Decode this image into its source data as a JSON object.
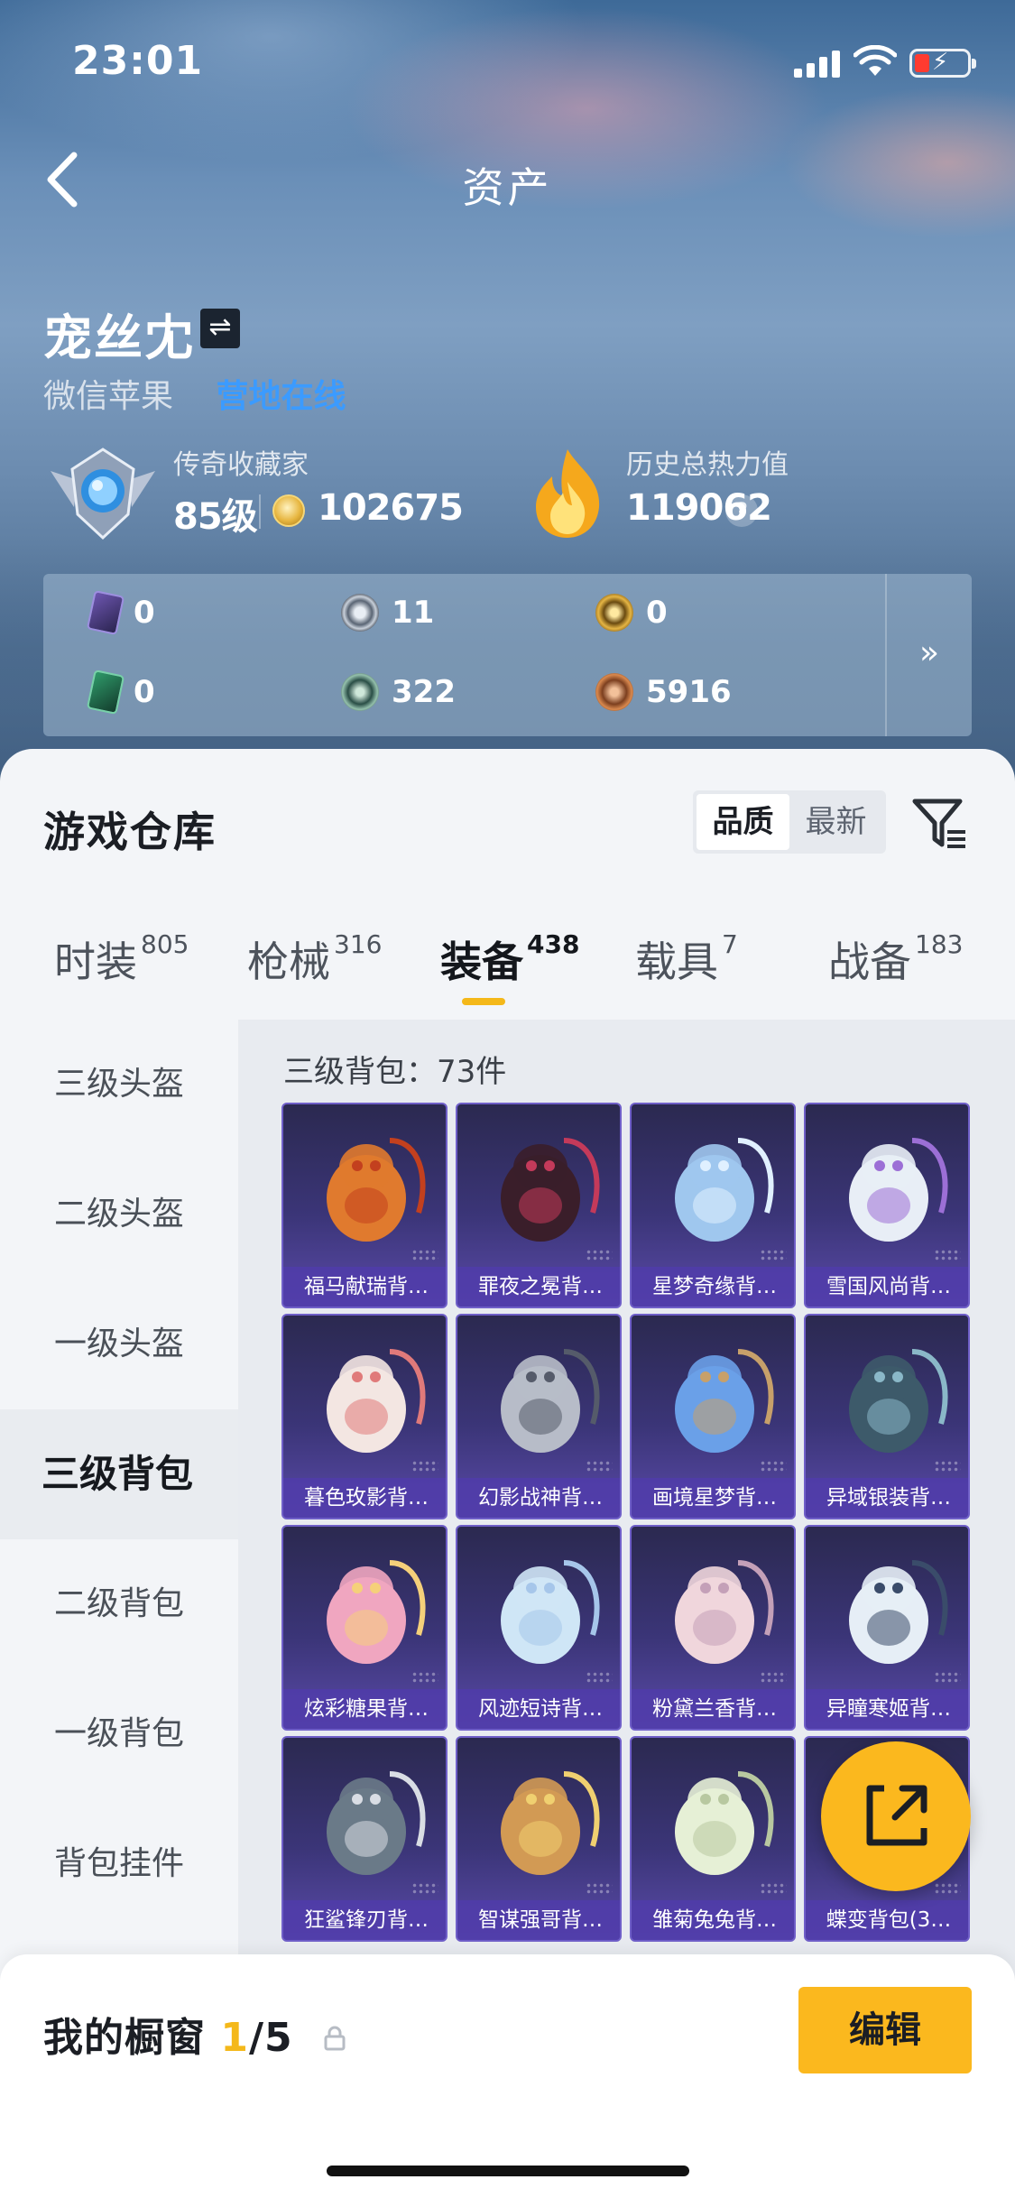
{
  "status_bar": {
    "time": "23:01"
  },
  "nav": {
    "title": "资产"
  },
  "profile": {
    "name": "宠丝冘",
    "platform": "微信苹果",
    "online_status": "营地在线"
  },
  "stats": {
    "collector_label": "传奇收藏家",
    "level": "85级",
    "coins": "102675",
    "heat_label": "历史总热力值",
    "heat_value": "119062",
    "help": "?"
  },
  "currencies": [
    {
      "icon": "purple-card-icon",
      "value": "0"
    },
    {
      "icon": "silver-token-icon",
      "value": "11"
    },
    {
      "icon": "gold-token-icon",
      "value": "0"
    },
    {
      "icon": "green-card-icon",
      "value": "0"
    },
    {
      "icon": "teal-coin-icon",
      "value": "322"
    },
    {
      "icon": "bronze-coin-icon",
      "value": "5916"
    }
  ],
  "currency_more": "»",
  "warehouse": {
    "title": "游戏仓库",
    "sort_options": [
      "品质",
      "最新"
    ],
    "tabs": [
      {
        "label": "时装",
        "count": "805"
      },
      {
        "label": "枪械",
        "count": "316"
      },
      {
        "label": "装备",
        "count": "438"
      },
      {
        "label": "载具",
        "count": "7"
      },
      {
        "label": "战备",
        "count": "183"
      }
    ],
    "categories": [
      "三级头盔",
      "二级头盔",
      "一级头盔",
      "三级背包",
      "二级背包",
      "一级背包",
      "背包挂件"
    ],
    "content_header": "三级背包：73件",
    "items": [
      "福马献瑞背…",
      "罪夜之冕背…",
      "星梦奇缘背…",
      "雪国风尚背…",
      "暮色玫影背…",
      "幻影战神背…",
      "画境星梦背…",
      "异域银装背…",
      "炫彩糖果背…",
      "风迹短诗背…",
      "粉黛兰香背…",
      "异瞳寒姬背…",
      "狂鲨锋刃背…",
      "智谋强哥背…",
      "雏菊兔兔背…",
      "蝶变背包(3…"
    ]
  },
  "showcase": {
    "label": "我的橱窗",
    "current": "1",
    "total": "/5",
    "edit_label": "编辑"
  },
  "colors": {
    "accent": "#fbb81e",
    "online": "#3b9bff",
    "card_purple": "#3b3578"
  }
}
